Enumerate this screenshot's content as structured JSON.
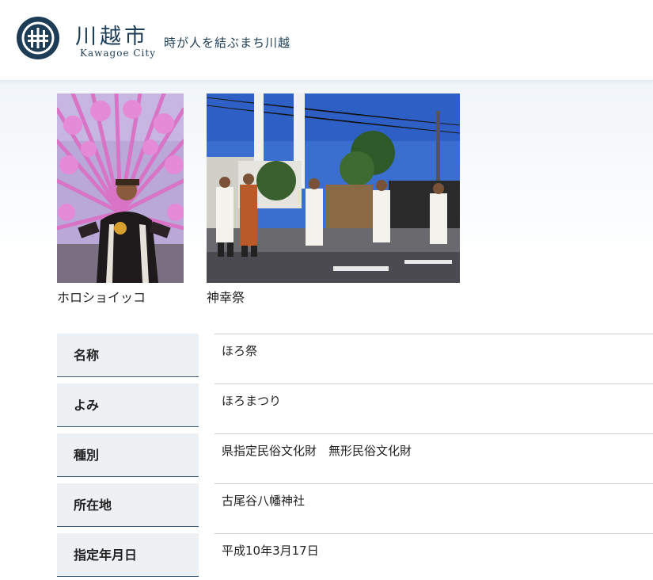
{
  "header": {
    "logo_title": "川越市",
    "logo_subtitle": "Kawagoe City",
    "catchphrase": "時が人を結ぶまち川越"
  },
  "photos": [
    {
      "caption": "ホロショイッコ",
      "icon": "festival-costume-photo"
    },
    {
      "caption": "神幸祭",
      "icon": "procession-photo"
    }
  ],
  "info_table": [
    {
      "label": "名称",
      "value": "ほろ祭"
    },
    {
      "label": "よみ",
      "value": "ほろまつり"
    },
    {
      "label": "種別",
      "value": "県指定民俗文化財　無形民俗文化財"
    },
    {
      "label": "所在地",
      "value": "古尾谷八幡神社"
    },
    {
      "label": "指定年月日",
      "value": "平成10年3月17日"
    }
  ],
  "colors": {
    "brand": "#1c3d55",
    "label_bg": "#eef1f4",
    "label_border": "#3a5a78"
  }
}
